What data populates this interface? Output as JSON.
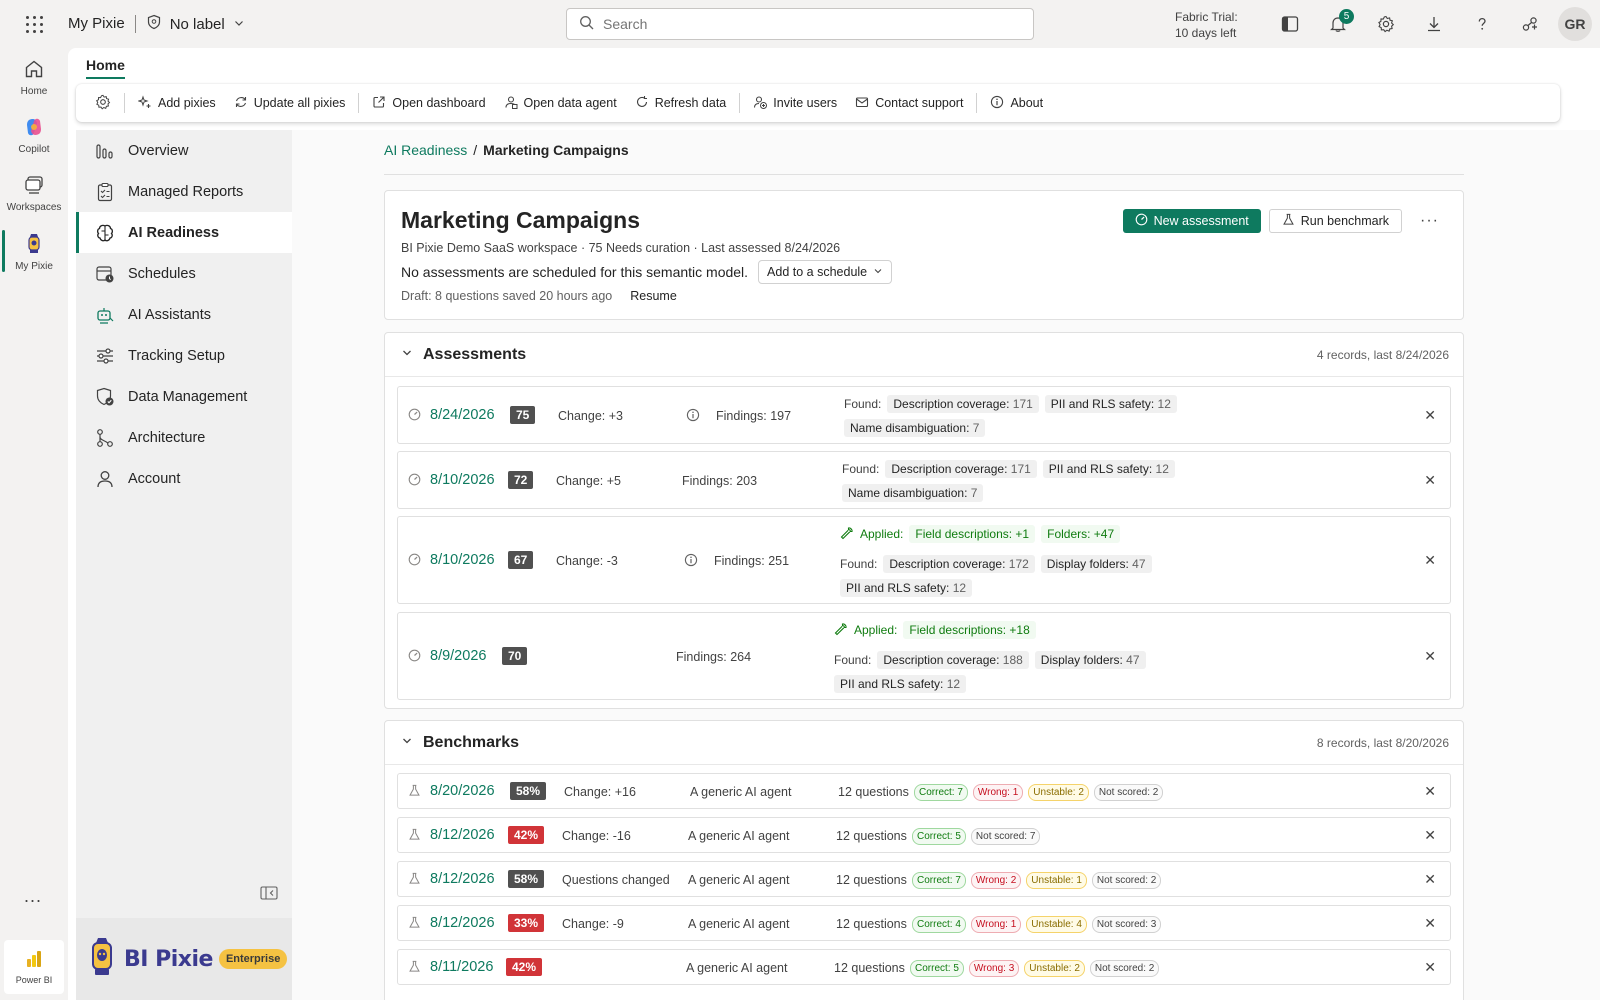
{
  "topbar": {
    "app_name": "My Pixie",
    "label": "No label",
    "search_placeholder": "Search",
    "trial_line1": "Fabric Trial:",
    "trial_line2": "10 days left",
    "notification_count": "5",
    "avatar_initials": "GR"
  },
  "rail": {
    "items": [
      {
        "label": "Home"
      },
      {
        "label": "Copilot"
      },
      {
        "label": "Workspaces"
      },
      {
        "label": "My Pixie"
      }
    ],
    "more": "...",
    "power_bi": "Power BI"
  },
  "tabs": {
    "home": "Home"
  },
  "toolbar": {
    "add_pixies": "Add pixies",
    "update_all_pixies": "Update all pixies",
    "open_dashboard": "Open dashboard",
    "open_data_agent": "Open data agent",
    "refresh_data": "Refresh data",
    "invite_users": "Invite users",
    "contact_support": "Contact support",
    "about": "About"
  },
  "subnav": {
    "items": [
      {
        "label": "Overview"
      },
      {
        "label": "Managed Reports"
      },
      {
        "label": "AI Readiness"
      },
      {
        "label": "Schedules"
      },
      {
        "label": "AI Assistants"
      },
      {
        "label": "Tracking Setup"
      },
      {
        "label": "Data Management"
      },
      {
        "label": "Architecture"
      },
      {
        "label": "Account"
      }
    ],
    "active_index": 2,
    "brand_name": "BI Pixie",
    "brand_tag": "Enterprise"
  },
  "breadcrumb": {
    "parent": "AI Readiness",
    "separator": "/",
    "current": "Marketing Campaigns"
  },
  "header": {
    "title": "Marketing Campaigns",
    "meta": "BI Pixie Demo SaaS workspace · 75 Needs curation · Last assessed 8/24/2026",
    "schedule_text": "No assessments are scheduled for this semantic model.",
    "schedule_button": "Add to a schedule",
    "draft_text": "Draft: 8 questions saved 20 hours ago",
    "resume": "Resume",
    "new_assessment": "New assessment",
    "run_benchmark": "Run benchmark"
  },
  "assessments": {
    "title": "Assessments",
    "count": "4 records, last 8/24/2026",
    "found_label": "Found:",
    "applied_label": "Applied:",
    "rows": [
      {
        "date": "8/24/2026",
        "score": "75",
        "change": "Change: +3",
        "findings": "Findings: 197",
        "found": [
          [
            "Description coverage:",
            "171"
          ],
          [
            "PII and RLS safety:",
            "12"
          ]
        ],
        "found2": [
          [
            "Name disambiguation:",
            "7"
          ]
        ]
      },
      {
        "date": "8/10/2026",
        "score": "72",
        "change": "Change: +5",
        "findings": "Findings: 203",
        "found": [
          [
            "Description coverage:",
            "171"
          ],
          [
            "PII and RLS safety:",
            "12"
          ]
        ],
        "found2": [
          [
            "Name disambiguation:",
            "7"
          ]
        ]
      },
      {
        "date": "8/10/2026",
        "score": "67",
        "change": "Change: -3",
        "findings": "Findings: 251",
        "applied": [
          "Field descriptions: +1",
          "Folders: +47"
        ],
        "found": [
          [
            "Description coverage:",
            "172"
          ],
          [
            "Display folders:",
            "47"
          ]
        ],
        "found2": [
          [
            "PII and RLS safety:",
            "12"
          ]
        ]
      },
      {
        "date": "8/9/2026",
        "score": "70",
        "change": "",
        "findings": "Findings: 264",
        "applied": [
          "Field descriptions: +18"
        ],
        "found": [
          [
            "Description coverage:",
            "188"
          ],
          [
            "Display folders:",
            "47"
          ]
        ],
        "found2": [
          [
            "PII and RLS safety:",
            "12"
          ]
        ]
      }
    ]
  },
  "benchmarks": {
    "title": "Benchmarks",
    "count": "8 records, last 8/20/2026",
    "rows": [
      {
        "date": "8/20/2026",
        "score": "58%",
        "tone": "gray",
        "change": "Change: +16",
        "agent": "A generic AI agent",
        "questions": "12 questions",
        "pills": [
          [
            "correct",
            "Correct: 7"
          ],
          [
            "wrong",
            "Wrong: 1"
          ],
          [
            "unstable",
            "Unstable: 2"
          ],
          [
            "ns",
            "Not scored: 2"
          ]
        ]
      },
      {
        "date": "8/12/2026",
        "score": "42%",
        "tone": "red",
        "change": "Change: -16",
        "agent": "A generic AI agent",
        "questions": "12 questions",
        "pills": [
          [
            "correct",
            "Correct: 5"
          ],
          [
            "ns",
            "Not scored: 7"
          ]
        ]
      },
      {
        "date": "8/12/2026",
        "score": "58%",
        "tone": "gray",
        "change": "Questions changed",
        "agent": "A generic AI agent",
        "questions": "12 questions",
        "pills": [
          [
            "correct",
            "Correct: 7"
          ],
          [
            "wrong",
            "Wrong: 2"
          ],
          [
            "unstable",
            "Unstable: 1"
          ],
          [
            "ns",
            "Not scored: 2"
          ]
        ]
      },
      {
        "date": "8/12/2026",
        "score": "33%",
        "tone": "red",
        "change": "Change: -9",
        "agent": "A generic AI agent",
        "questions": "12 questions",
        "pills": [
          [
            "correct",
            "Correct: 4"
          ],
          [
            "wrong",
            "Wrong: 1"
          ],
          [
            "unstable",
            "Unstable: 4"
          ],
          [
            "ns",
            "Not scored: 3"
          ]
        ]
      },
      {
        "date": "8/11/2026",
        "score": "42%",
        "tone": "red",
        "change": "",
        "agent": "A generic AI agent",
        "questions": "12 questions",
        "pills": [
          [
            "correct",
            "Correct: 5"
          ],
          [
            "wrong",
            "Wrong: 3"
          ],
          [
            "unstable",
            "Unstable: 2"
          ],
          [
            "ns",
            "Not scored: 2"
          ]
        ]
      }
    ]
  },
  "colors": {
    "accent": "#0e7a5f",
    "danger": "#d13438",
    "score_gray": "#505050"
  },
  "icons": {
    "close": "close-icon",
    "gauge": "gauge-icon",
    "flask": "flask-icon",
    "info": "info-icon",
    "wrench": "wrench-icon"
  }
}
